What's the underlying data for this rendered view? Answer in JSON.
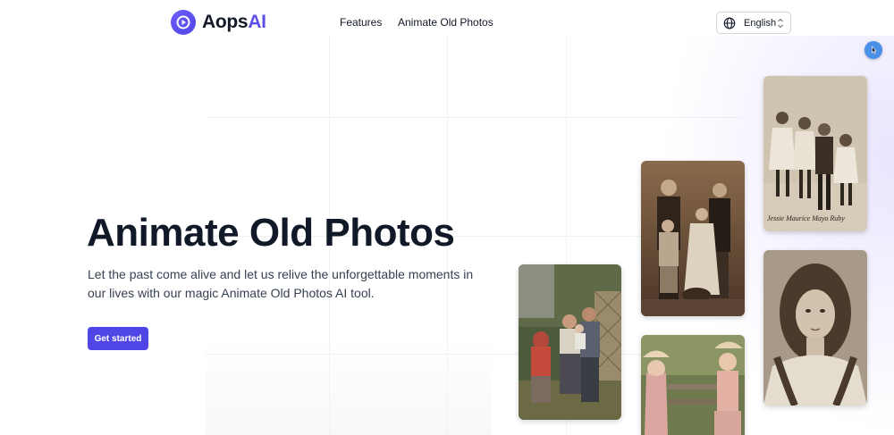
{
  "brand": {
    "name_main": "Aops",
    "name_accent": "AI",
    "accent_color": "#5b4fe6"
  },
  "nav": {
    "features_label": "Features",
    "animate_label": "Animate Old Photos"
  },
  "language": {
    "selected": "English"
  },
  "hero": {
    "title": "Animate Old Photos",
    "subtitle": "Let the past come alive and let us relive the unforgettable moments in our lives with our magic Animate Old Photos AI tool.",
    "cta_label": "Get started",
    "cta_color": "#4f46e5"
  },
  "gallery": {
    "photos": [
      {
        "name": "color-family-garden-photo",
        "tone": "color"
      },
      {
        "name": "sepia-family-portrait-photo",
        "tone": "sepia"
      },
      {
        "name": "color-girls-bench-photo",
        "tone": "color"
      },
      {
        "name": "sepia-four-children-photo",
        "tone": "sepia"
      },
      {
        "name": "sepia-girl-curly-hair-photo",
        "tone": "sepia"
      }
    ],
    "handwritten_caption": "Jessie Maurice Mayo Ruby"
  },
  "icons": [
    "logo-play-icon",
    "globe-icon",
    "select-caret-icon",
    "assistant-icon"
  ]
}
